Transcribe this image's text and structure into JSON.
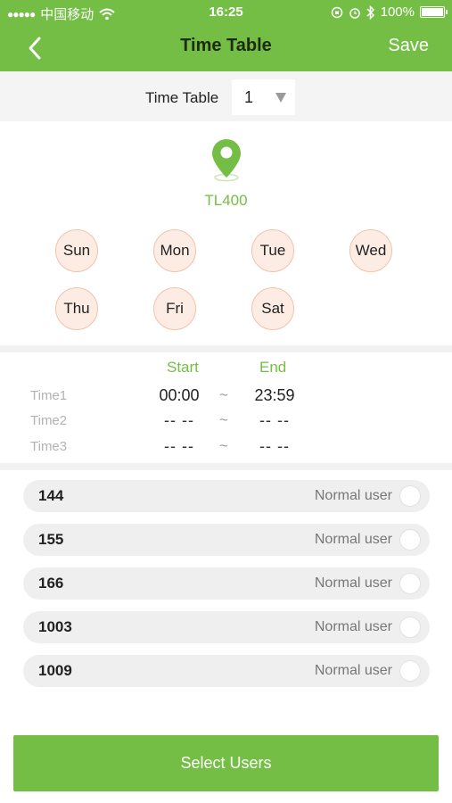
{
  "status_bar": {
    "carrier": "中国移动",
    "time": "16:25",
    "battery": "100%"
  },
  "nav": {
    "title": "Time Table",
    "save_label": "Save"
  },
  "timetable": {
    "label": "Time Table",
    "selected": "1"
  },
  "device": {
    "name": "TL400"
  },
  "days": [
    "Sun",
    "Mon",
    "Tue",
    "Wed",
    "Thu",
    "Fri",
    "Sat"
  ],
  "times": {
    "start_label": "Start",
    "end_label": "End",
    "separator": "~",
    "rows": [
      {
        "label": "Time1",
        "start": "00:00",
        "end": "23:59"
      },
      {
        "label": "Time2",
        "start": "-- --",
        "end": "-- --"
      },
      {
        "label": "Time3",
        "start": "-- --",
        "end": "-- --"
      }
    ]
  },
  "users": [
    {
      "id": "144",
      "type": "Normal user"
    },
    {
      "id": "155",
      "type": "Normal user"
    },
    {
      "id": "166",
      "type": "Normal user"
    },
    {
      "id": "1003",
      "type": "Normal user"
    },
    {
      "id": "1009",
      "type": "Normal user"
    }
  ],
  "colors": {
    "accent": "#74be45",
    "day_fill": "#fdece4",
    "day_border": "#f1c3a9"
  },
  "actions": {
    "select_users_label": "Select Users"
  }
}
